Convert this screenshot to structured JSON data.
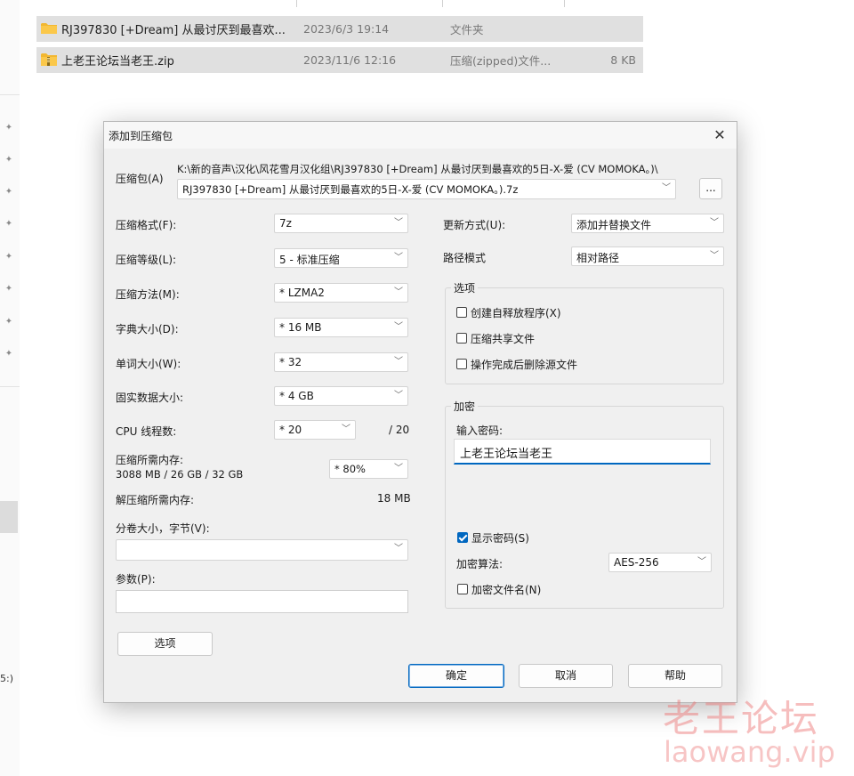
{
  "explorer": {
    "files": [
      {
        "name": "RJ397830 [+Dream] 从最讨厌到最喜欢...",
        "date": "2023/6/3 19:14",
        "type": "文件夹",
        "size": ""
      },
      {
        "name": "上老王论坛当老王.zip",
        "date": "2023/11/6 12:16",
        "type": "压缩(zipped)文件...",
        "size": "8 KB"
      }
    ],
    "side_text": "5:)"
  },
  "dialog": {
    "title": "添加到压缩包",
    "close_glyph": "✕",
    "archive_label": "压缩包(A)",
    "archive_path": "K:\\新的音声\\汉化\\风花雪月汉化组\\RJ397830 [+Dream] 从最讨厌到最喜欢的5日-X-爱 (CV MOMOKA。)\\",
    "archive_name": "RJ397830 [+Dream] 从最讨厌到最喜欢的5日-X-爱 (CV MOMOKA。).7z",
    "browse_label": "...",
    "format_label": "压缩格式(F):",
    "format_value": "7z",
    "level_label": "压缩等级(L):",
    "level_value": "5 - 标准压缩",
    "method_label": "压缩方法(M):",
    "method_value": "* LZMA2",
    "dict_label": "字典大小(D):",
    "dict_value": "* 16 MB",
    "word_label": "单词大小(W):",
    "word_value": "* 32",
    "solid_label": "固实数据大小:",
    "solid_value": "* 4 GB",
    "cpu_label": "CPU 线程数:",
    "cpu_value": "* 20",
    "cpu_total": "/ 20",
    "mem_label": "压缩所需内存:",
    "mem_value": "3088 MB / 26 GB / 32 GB",
    "mem_percent": "* 80%",
    "decomp_label": "解压缩所需内存:",
    "decomp_value": "18 MB",
    "split_label": "分卷大小，字节(V):",
    "split_value": "",
    "params_label": "参数(P):",
    "params_value": "",
    "options_button": "选项",
    "update_label": "更新方式(U):",
    "update_value": "添加并替换文件",
    "path_label": "路径模式",
    "path_value": "相对路径",
    "options_group": "选项",
    "opt_sfx": "创建自释放程序(X)",
    "opt_shared": "压缩共享文件",
    "opt_delete": "操作完成后删除源文件",
    "encrypt_group": "加密",
    "password_label": "输入密码:",
    "password_value": "上老王论坛当老王",
    "show_password": "显示密码(S)",
    "algo_label": "加密算法:",
    "algo_value": "AES-256",
    "encrypt_names": "加密文件名(N)",
    "ok": "确定",
    "cancel": "取消",
    "help": "帮助"
  },
  "watermark": {
    "cn": "老王论坛",
    "url": "laowang.vip"
  }
}
